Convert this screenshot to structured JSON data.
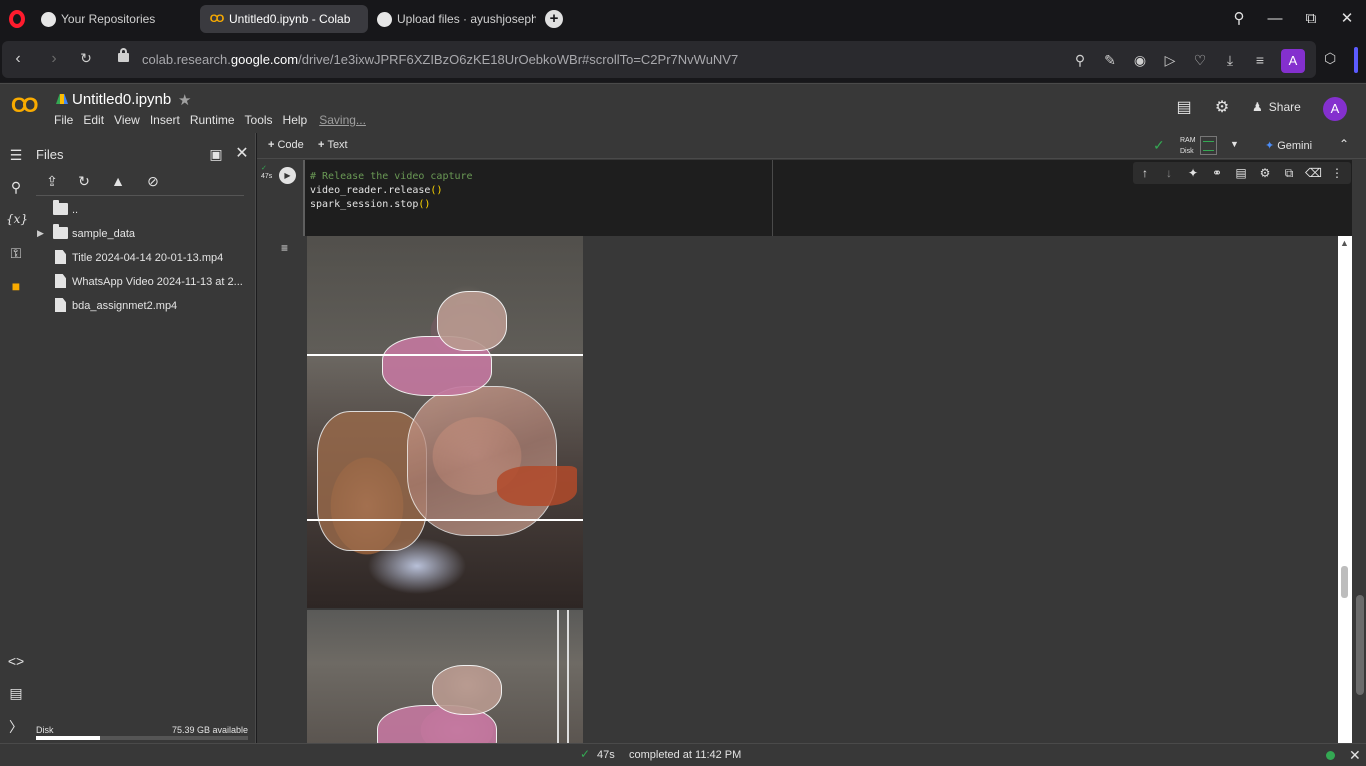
{
  "browser": {
    "tabs": [
      {
        "label": "Your Repositories",
        "icon": "github-icon"
      },
      {
        "label": "Untitled0.ipynb - Colab",
        "icon": "colab-icon",
        "active": true
      },
      {
        "label": "Upload files · ayushjoseph",
        "icon": "github-icon"
      }
    ],
    "url_prefix": "colab.research.",
    "url_domain": "google.com",
    "url_path": "/drive/1e3ixwJPRF6XZIBzO6zKE18UrOebkoWBr#scrollTo=C2Pr7NvWuNV7",
    "profile_initial": "A"
  },
  "colab": {
    "logo": "CO",
    "notebook_title": "Untitled0.ipynb",
    "menu": [
      "File",
      "Edit",
      "View",
      "Insert",
      "Runtime",
      "Tools",
      "Help"
    ],
    "saving": "Saving...",
    "share": "Share",
    "user_initial": "A"
  },
  "files_panel": {
    "title": "Files",
    "items": [
      {
        "type": "folder",
        "label": ".."
      },
      {
        "type": "folder",
        "label": "sample_data"
      },
      {
        "type": "file",
        "label": "Title 2024-04-14 20-01-13.mp4"
      },
      {
        "type": "file",
        "label": "WhatsApp Video 2024-11-13 at 2..."
      },
      {
        "type": "file",
        "label": "bda_assignmet2.mp4"
      }
    ],
    "disk_label": "Disk",
    "disk_available": "75.39 GB available",
    "disk_used_fraction": 0.3
  },
  "toolbar": {
    "code_label": "Code",
    "text_label": "Text",
    "ram_label": "RAM",
    "disk_label": "Disk",
    "gemini_label": "Gemini"
  },
  "cell": {
    "exec_time": "47s",
    "lines": [
      {
        "text": "# Release the video capture",
        "kind": "comment"
      },
      {
        "prefix": "video_reader.release",
        "paren": "()"
      },
      {
        "prefix": "spark_session.stop",
        "paren": "()"
      }
    ]
  },
  "status": {
    "duration": "47s",
    "message": "completed at 11:42 PM"
  }
}
